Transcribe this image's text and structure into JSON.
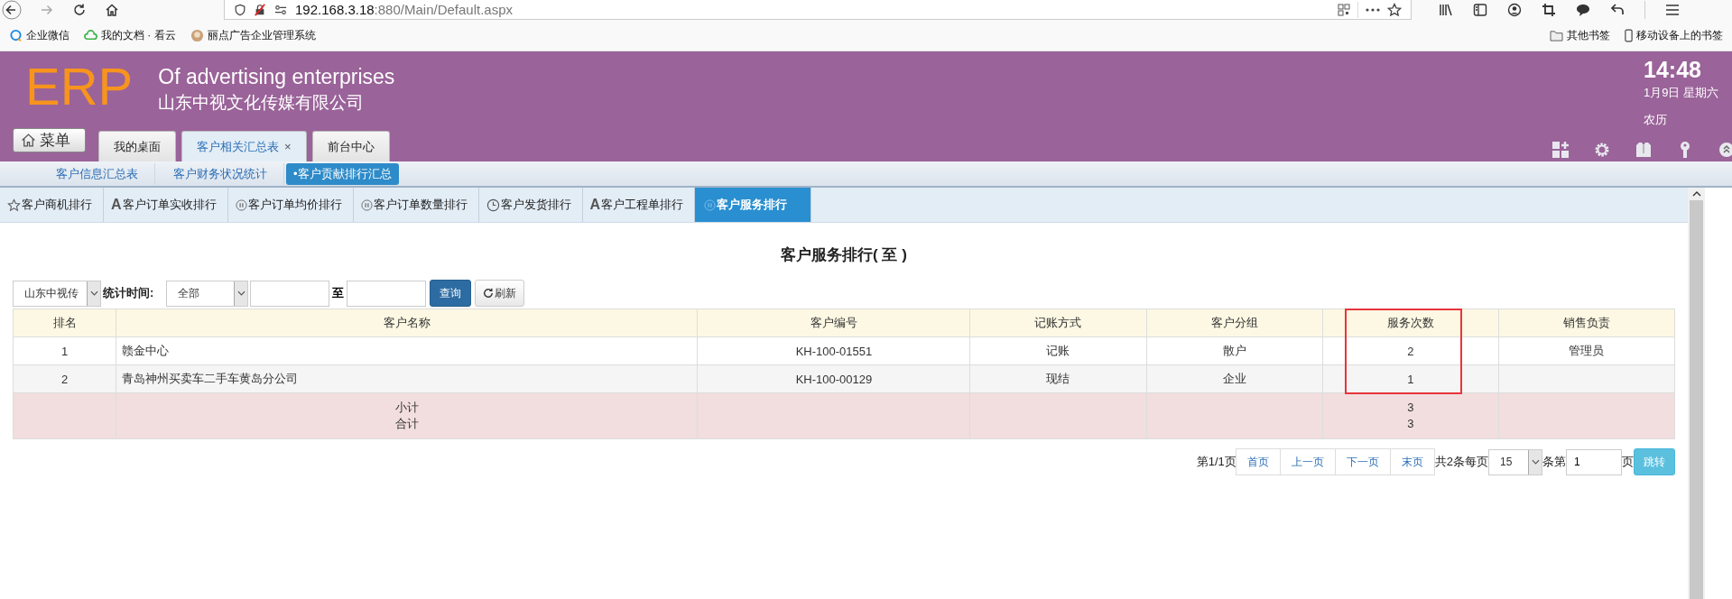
{
  "browser": {
    "url_host": "192.168.3.18",
    "url_rest": ":880/Main/Default.aspx",
    "bookmarks": [
      {
        "label": "企业微信",
        "kind": "chat"
      },
      {
        "label": "我的文档 · 看云",
        "kind": "cloud"
      },
      {
        "label": "丽点广告企业管理系统",
        "kind": "avatar"
      }
    ],
    "bookmarks_right": [
      {
        "label": "其他书签",
        "kind": "folder"
      },
      {
        "label": "移动设备上的书签",
        "kind": "phone"
      }
    ]
  },
  "header": {
    "logo": "ERP",
    "subtitle": "Of advertising enterprises",
    "company": "山东中视文化传媒有限公司",
    "menu_button": "菜单",
    "time": "14:48",
    "date": "1月9日 星期六",
    "lunar": "农历"
  },
  "tabs": [
    {
      "label": "我的桌面",
      "selected": false
    },
    {
      "label": "客户相关汇总表",
      "selected": true,
      "close": "×"
    },
    {
      "label": "前台中心",
      "selected": false
    }
  ],
  "subnav": [
    {
      "label": "客户信息汇总表",
      "selected": false
    },
    {
      "label": "客户财务状况统计",
      "selected": false
    },
    {
      "label": "•客户贡献排行汇总",
      "selected": true
    }
  ],
  "report_tabs": [
    {
      "label": "客户商机排行",
      "kind": "star",
      "selected": false
    },
    {
      "label": "客户订单实收排行",
      "kind": "letter",
      "glyph": "A",
      "selected": false
    },
    {
      "label": "客户订单均价排行",
      "kind": "pause",
      "selected": false
    },
    {
      "label": "客户订单数量排行",
      "kind": "pause",
      "selected": false
    },
    {
      "label": "客户发货排行",
      "kind": "clock",
      "selected": false
    },
    {
      "label": "客户工程单排行",
      "kind": "letter",
      "glyph": "A",
      "selected": false
    },
    {
      "label": "客户服务排行",
      "kind": "pause",
      "selected": true
    }
  ],
  "report": {
    "title": "客户服务排行( 至 )",
    "filters": {
      "company": "山东中视传",
      "time_label": "统计时间:",
      "period": "全部",
      "to": "至",
      "query_button": "查询",
      "refresh_button": "刷新"
    },
    "table": {
      "columns": [
        {
          "label": "排名",
          "highlight": false
        },
        {
          "label": "客户名称",
          "highlight": false
        },
        {
          "label": "客户编号",
          "highlight": false
        },
        {
          "label": "记账方式",
          "highlight": false
        },
        {
          "label": "客户分组",
          "highlight": false
        },
        {
          "label": "服务次数",
          "highlight": true
        },
        {
          "label": "销售负责",
          "highlight": false
        }
      ],
      "rows": [
        [
          "1",
          "赣金中心",
          "KH-100-01551",
          "记账",
          "散户",
          "2",
          "管理员"
        ],
        [
          "2",
          "青岛神州买卖车二手车黄岛分公司",
          "KH-100-00129",
          "现结",
          "企业",
          "1",
          ""
        ]
      ],
      "totals": [
        {
          "label": "小计",
          "value": "3"
        },
        {
          "label": "合计",
          "value": "3"
        }
      ]
    },
    "pagination": {
      "page_info": "第1/1页",
      "buttons": [
        "首页",
        "上一页",
        "下一页",
        "末页"
      ],
      "count_text": "共2条每页",
      "page_size": "15",
      "goto_prefix": "条第",
      "goto_page": "1",
      "goto_suffix": "页",
      "goto_button": "跳转"
    }
  }
}
